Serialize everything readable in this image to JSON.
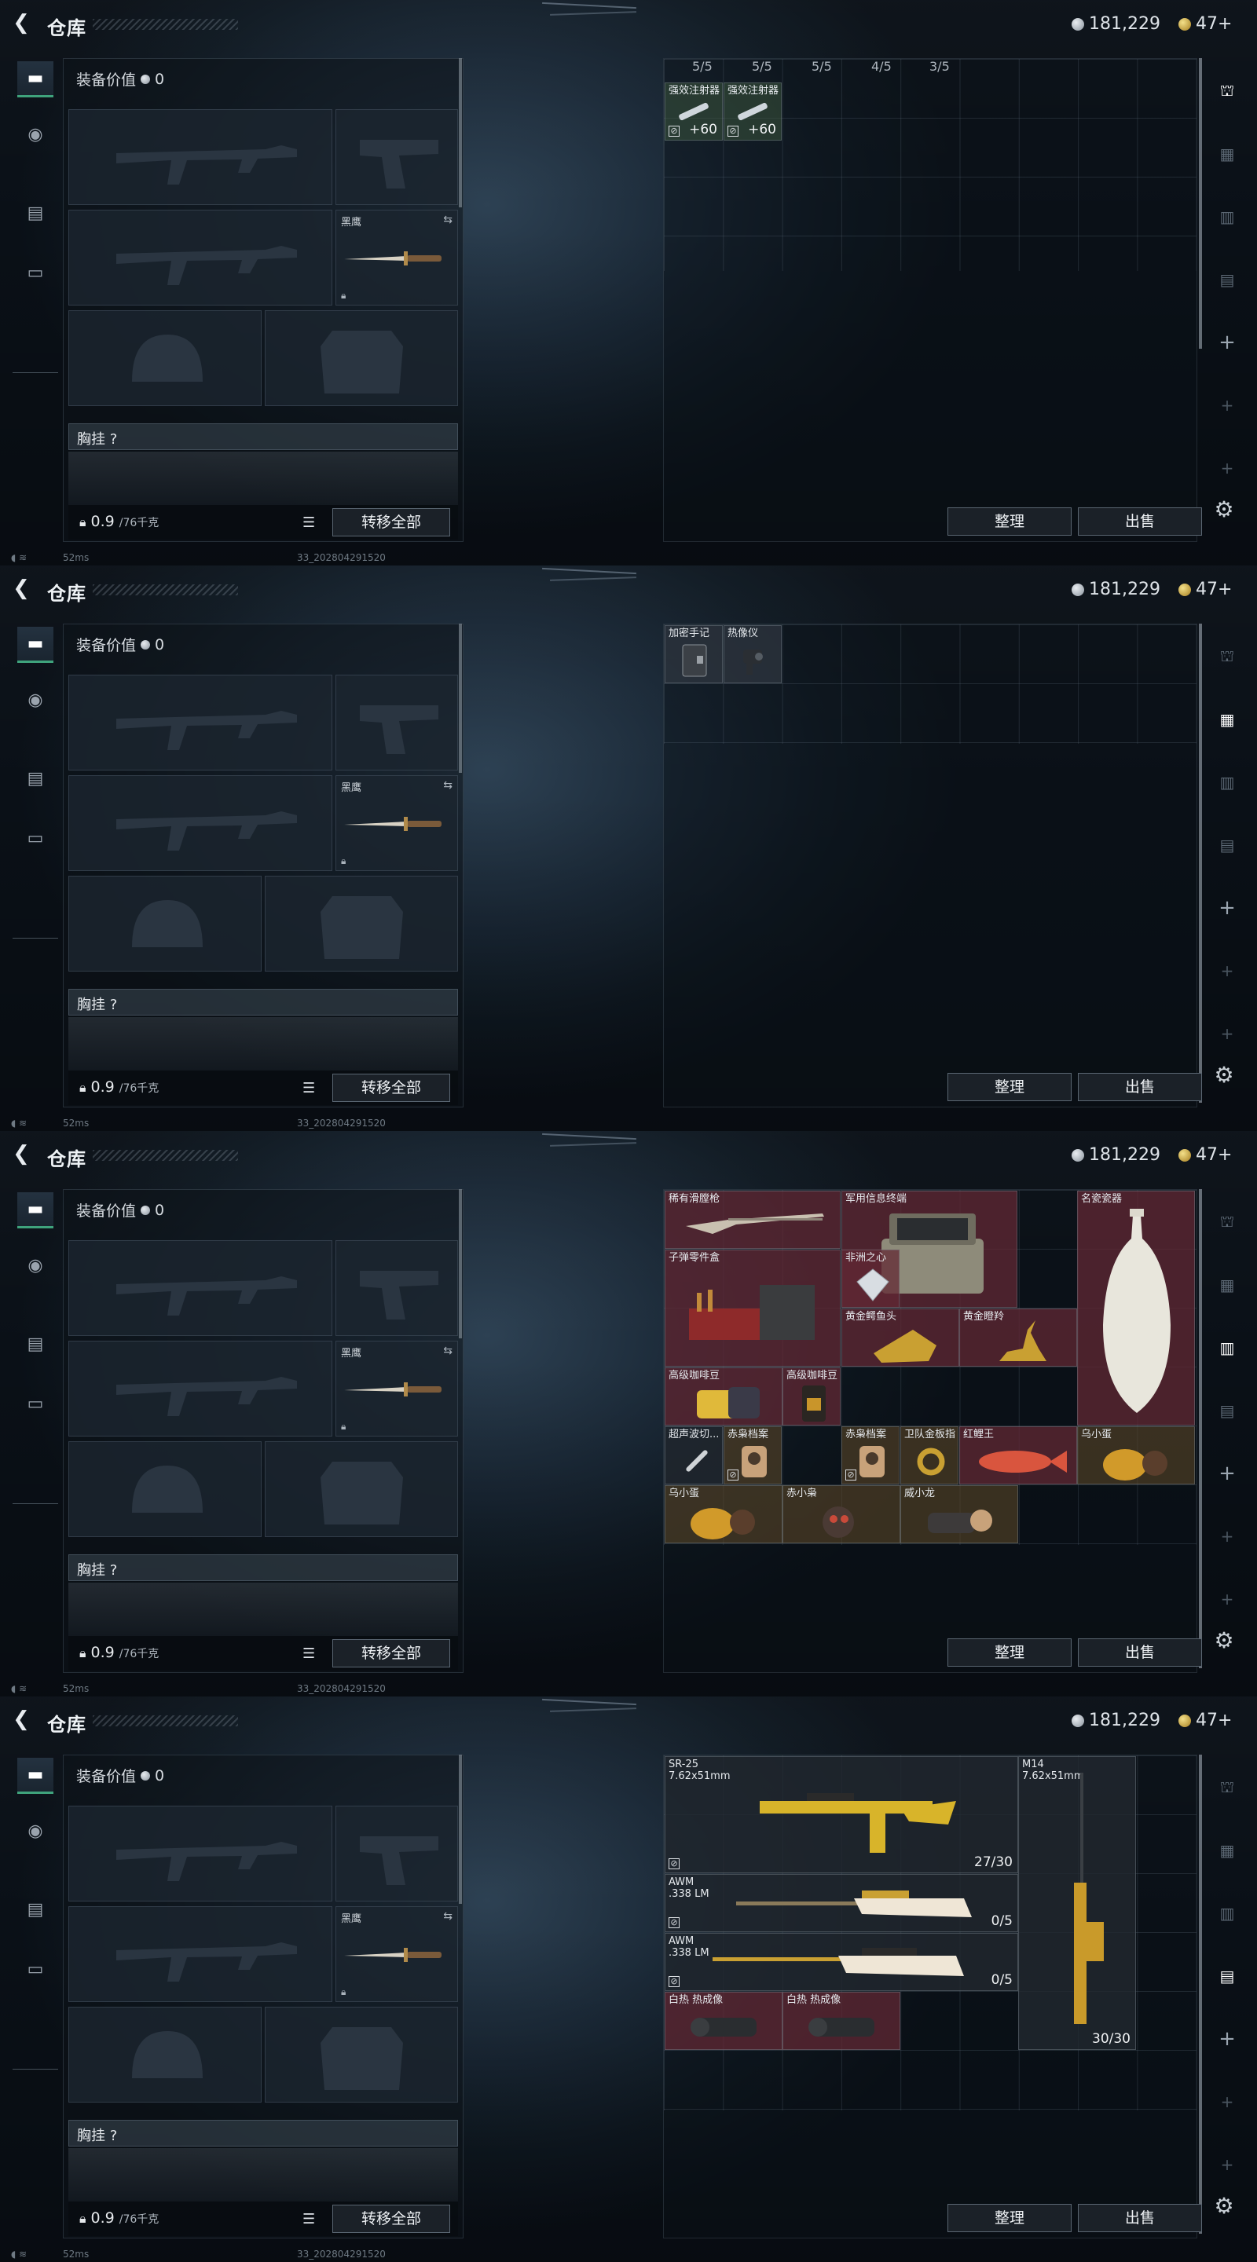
{
  "screens": [
    {
      "title": "仓库",
      "currency": {
        "silver": "181,229",
        "gold": "47+"
      },
      "equip_value_label": "装备价值",
      "equip_value": "0",
      "knife_label": "黑鹰",
      "chest_label": "胸挂",
      "chest_hint": "?",
      "weight": "0.9",
      "weight_cap": "/76千克",
      "transfer_all": "转移全部",
      "sort": "整理",
      "sell": "出售",
      "ping": "52ms",
      "version": "33_202804291520",
      "ammo_counts": [
        "5/5",
        "5/5",
        "5/5",
        "4/5",
        "3/5"
      ],
      "items": [
        {
          "name": "强效注射器",
          "count": "+60"
        },
        {
          "name": "强效注射器",
          "count": "+60"
        }
      ]
    },
    {
      "title": "仓库",
      "currency": {
        "silver": "181,229",
        "gold": "47+"
      },
      "equip_value_label": "装备价值",
      "equip_value": "0",
      "knife_label": "黑鹰",
      "chest_label": "胸挂",
      "chest_hint": "?",
      "weight": "0.9",
      "weight_cap": "/76千克",
      "transfer_all": "转移全部",
      "sort": "整理",
      "sell": "出售",
      "ping": "52ms",
      "version": "33_202804291520",
      "items": [
        {
          "name": "加密手记"
        },
        {
          "name": "热像仪"
        }
      ]
    },
    {
      "title": "仓库",
      "currency": {
        "silver": "181,229",
        "gold": "47+"
      },
      "equip_value_label": "装备价值",
      "equip_value": "0",
      "knife_label": "黑鹰",
      "chest_label": "胸挂",
      "chest_hint": "?",
      "weight": "0.9",
      "weight_cap": "/76千克",
      "transfer_all": "转移全部",
      "sort": "整理",
      "sell": "出售",
      "ping": "52ms",
      "version": "33_202804291520",
      "items": [
        {
          "name": "稀有滑膛枪"
        },
        {
          "name": "军用信息终端"
        },
        {
          "name": "名瓷瓷器"
        },
        {
          "name": "子弹零件盒"
        },
        {
          "name": "非洲之心"
        },
        {
          "name": "黄金鳄鱼头"
        },
        {
          "name": "黄金瞪羚"
        },
        {
          "name": "高级咖啡豆"
        },
        {
          "name": "高级咖啡豆"
        },
        {
          "name": "超声波切..."
        },
        {
          "name": "赤枭档案"
        },
        {
          "name": "赤枭档案"
        },
        {
          "name": "卫队金板指"
        },
        {
          "name": "红鲤王"
        },
        {
          "name": "乌小蛋"
        },
        {
          "name": "乌小蛋"
        },
        {
          "name": "赤小枭"
        },
        {
          "name": "威小龙"
        }
      ]
    },
    {
      "title": "仓库",
      "currency": {
        "silver": "181,229",
        "gold": "47+"
      },
      "equip_value_label": "装备价值",
      "equip_value": "0",
      "knife_label": "黑鹰",
      "chest_label": "胸挂",
      "chest_hint": "?",
      "weight": "0.9",
      "weight_cap": "/76千克",
      "transfer_all": "转移全部",
      "sort": "整理",
      "sell": "出售",
      "ping": "52ms",
      "version": "33_202804291520",
      "items": [
        {
          "name": "SR-25",
          "caliber": "7.62x51mm",
          "count": "27/30"
        },
        {
          "name": "M14",
          "caliber": "7.62x51mm",
          "count": "30/30"
        },
        {
          "name": "AWM",
          "caliber": ".338 LM",
          "count": "0/5"
        },
        {
          "name": "AWM",
          "caliber": ".338 LM",
          "count": "0/5"
        },
        {
          "name": "白热 热成像"
        },
        {
          "name": "白热 热成像"
        }
      ]
    }
  ],
  "icons": {
    "back": "back-arrow-icon",
    "silver": "silver-coin-icon",
    "gold": "gold-coin-icon",
    "gear": "gear-icon",
    "lock": "lock-icon",
    "list": "list-icon"
  }
}
